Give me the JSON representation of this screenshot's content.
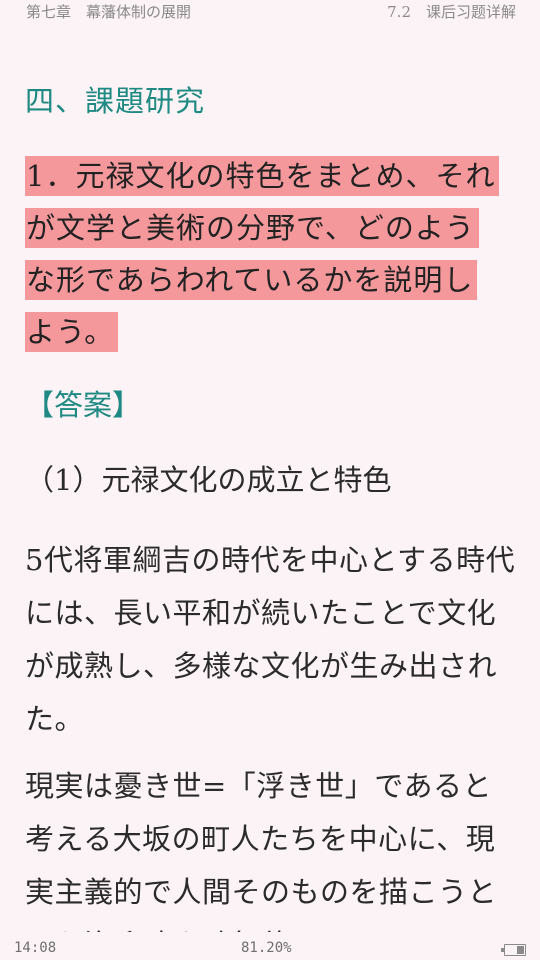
{
  "header": {
    "chapter": "第七章　幕藩体制の展開",
    "section": "7.2　课后习题详解"
  },
  "content": {
    "section_heading": "四、課題研究",
    "question_lines": [
      "1．元禄文化の特色をまとめ、それ",
      "が文学と美術の分野で、どのよう",
      "な形であらわれているかを説明し",
      "よう。"
    ],
    "answer_label": "【答案】",
    "subheading": "（1）元禄文化の成立と特色",
    "paragraph1": "5代将軍綱吉の時代を中心とする時代には、長い平和が続いたことで文化が成熟し、多様な文化が生み出された。",
    "paragraph2": "現実は憂き世=「浮き世」であると考える大坂の町人たちを中心に、現実主義的で人間そのものを描こうとした浄瑠璃や歌舞伎は、その"
  },
  "footer": {
    "time": "14:08",
    "progress": "81.20%",
    "battery_level": 0.4
  },
  "colors": {
    "background": "#fbf3f6",
    "heading_teal": "#1f8a83",
    "highlight_pink": "#f4989c"
  }
}
